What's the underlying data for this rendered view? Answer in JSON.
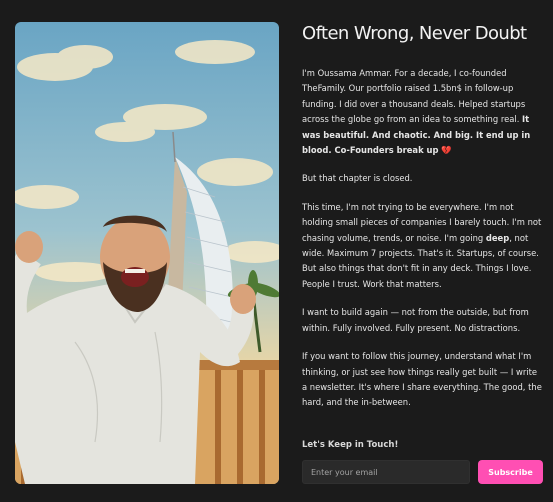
{
  "title": "Often Wrong, Never Doubt",
  "p1": {
    "a": "I'm Oussama Ammar. For a decade, I co-founded TheFamily. Our portfolio raised 1.5bn$ in follow-up funding. I did over a thousand deals. Helped startups across the globe go from an idea to something real. ",
    "b": "It was beautiful. And chaotic. And big. It end up in blood. Co-Founders break up ",
    "heart": "💔"
  },
  "p2": "But that chapter is closed.",
  "p3": {
    "a": "This time, I'm not trying to be everywhere. I'm not holding small pieces of companies I barely touch. I'm not chasing volume, trends, or noise. I'm going ",
    "b": "deep",
    "c": ", not wide. Maximum 7 projects. That's it. Startups, of course. But also things that don't fit in any deck. Things I love. People I trust. Work that matters."
  },
  "p4": "I want to build again — not from the outside, but from within. Fully involved. Fully present. No distractions.",
  "p5": "If you want to follow this journey, understand what I'm thinking, or just see how things really get built — I write a newsletter. It's where I share everything. The good, the hard, and the in-between.",
  "signup": {
    "heading": "Let's Keep in Touch!",
    "placeholder": "Enter your email",
    "button": "Subscribe"
  },
  "colors": {
    "background": "#1b1b1b",
    "accent": "#ff4fb3",
    "heart": "#d32f3f"
  }
}
